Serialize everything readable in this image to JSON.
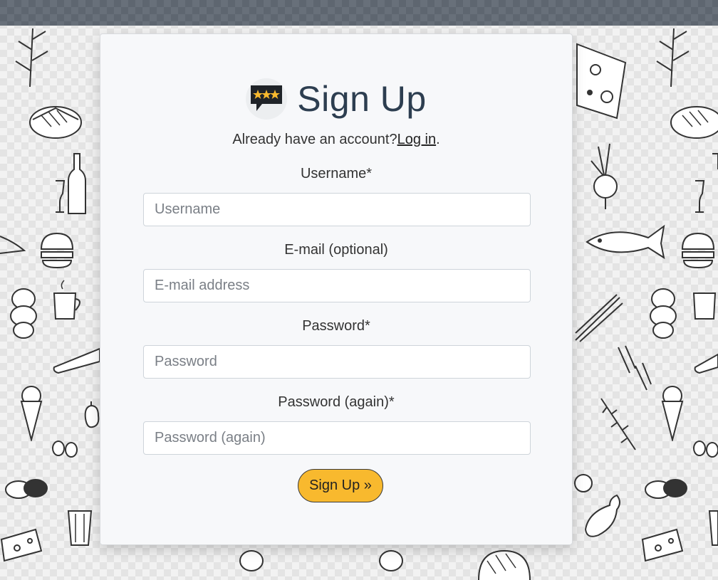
{
  "page": {
    "title": "Sign Up",
    "subtitle_prefix": "Already have an account?",
    "login_link": "Log in",
    "subtitle_suffix": "."
  },
  "logo": {
    "icon": "rating-speech-bubble-icon",
    "star_color": "#f8b92e"
  },
  "form": {
    "username_label": "Username*",
    "username_placeholder": "Username",
    "email_label": "E-mail (optional)",
    "email_placeholder": "E-mail address",
    "password_label": "Password*",
    "password_placeholder": "Password",
    "password2_label": "Password (again)*",
    "password2_placeholder": "Password (again)",
    "submit_label": "Sign Up »"
  },
  "colors": {
    "accent": "#f8b92e",
    "title": "#2d3e50",
    "topbar": "#5e6670",
    "card": "#f7f8fa"
  }
}
